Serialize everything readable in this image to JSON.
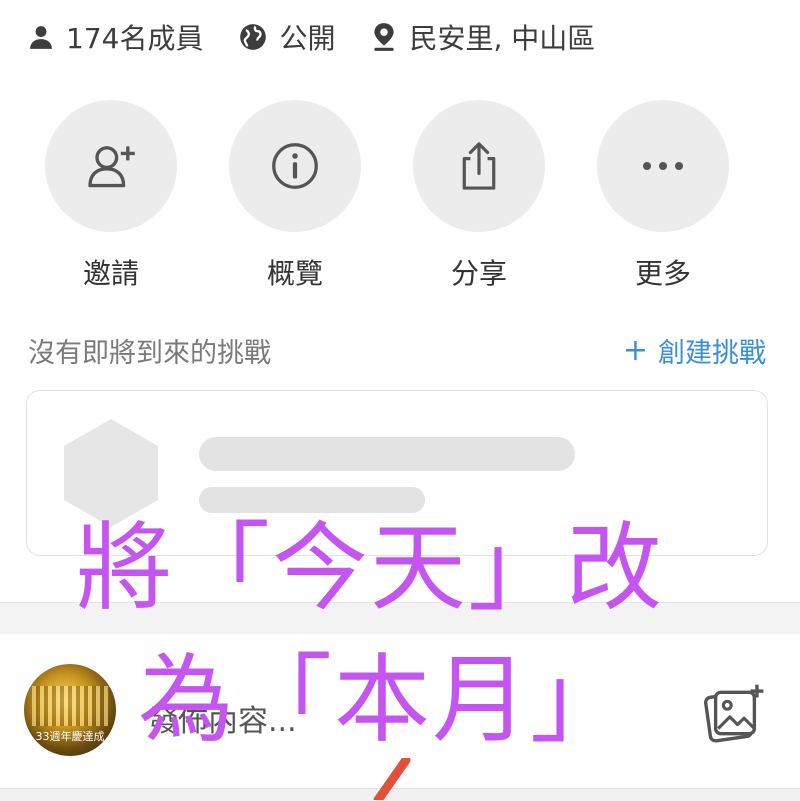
{
  "meta": {
    "members": "174名成員",
    "privacy": "公開",
    "location": "民安里, 中山區"
  },
  "actions": [
    {
      "label": "邀請",
      "icon": "add-person-icon"
    },
    {
      "label": "概覽",
      "icon": "info-icon"
    },
    {
      "label": "分享",
      "icon": "share-icon"
    },
    {
      "label": "更多",
      "icon": "more-dots-icon"
    }
  ],
  "challenges": {
    "empty_text": "沒有即將到來的挑戰",
    "create_label": "創建挑戰"
  },
  "composer": {
    "placeholder": "發佈內容...",
    "avatar_caption": "33週年慶達成"
  },
  "annotation": {
    "line1": "將「今天」改",
    "line2": "為「本月」",
    "color": "#c555f0"
  },
  "colors": {
    "accent": "#3a8fd6",
    "button_bg": "#ececec"
  }
}
